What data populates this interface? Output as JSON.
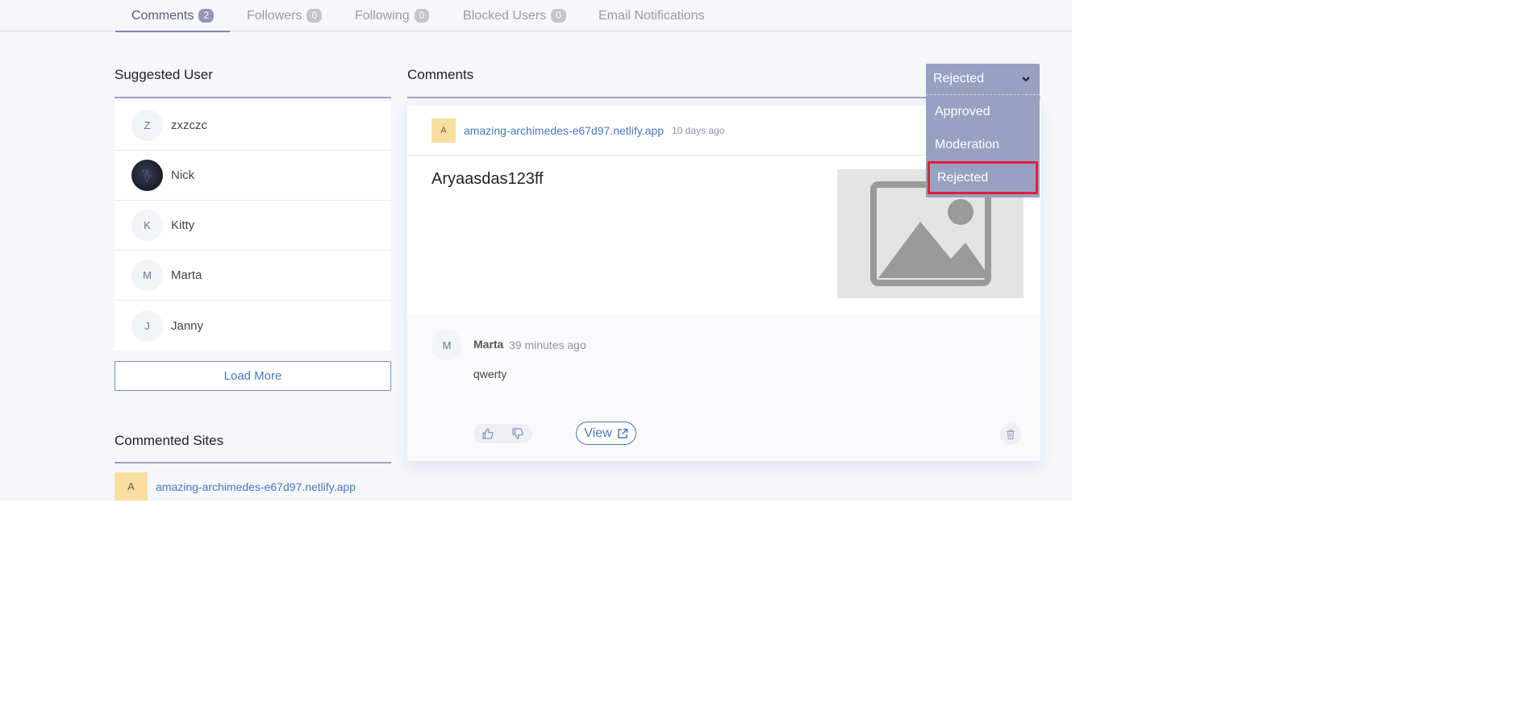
{
  "tabs": [
    {
      "label": "Comments",
      "count": "2"
    },
    {
      "label": "Followers",
      "count": "0"
    },
    {
      "label": "Following",
      "count": "0"
    },
    {
      "label": "Blocked Users",
      "count": "0"
    },
    {
      "label": "Email Notifications"
    }
  ],
  "suggested": {
    "title": "Suggested User",
    "users": [
      {
        "initial": "Z",
        "name": "zxzczc"
      },
      {
        "initial": "",
        "name": "Nick"
      },
      {
        "initial": "K",
        "name": "Kitty"
      },
      {
        "initial": "M",
        "name": "Marta"
      },
      {
        "initial": "J",
        "name": "Janny"
      }
    ],
    "load_more": "Load More"
  },
  "commented_sites": {
    "title": "Commented Sites",
    "sites": [
      {
        "initial": "A",
        "name": "amazing-archimedes-e67d97.netlify.app"
      }
    ]
  },
  "comments": {
    "title": "Comments",
    "filter": {
      "selected": "Rejected",
      "options": [
        "Approved",
        "Moderation",
        "Rejected"
      ]
    },
    "card": {
      "site_initial": "A",
      "site": "amazing-archimedes-e67d97.netlify.app",
      "time": "10 days ago",
      "post_title": "Aryaasdas123ff",
      "reply": {
        "initial": "M",
        "author": "Marta",
        "time": "39 minutes ago",
        "text": "qwerty"
      },
      "view_label": "View"
    }
  },
  "colors": {
    "accent": "#4a78c0",
    "dropdown_bg": "#99a1c2",
    "highlight": "#e0203a",
    "site_avatar": "#f8dfa0"
  }
}
